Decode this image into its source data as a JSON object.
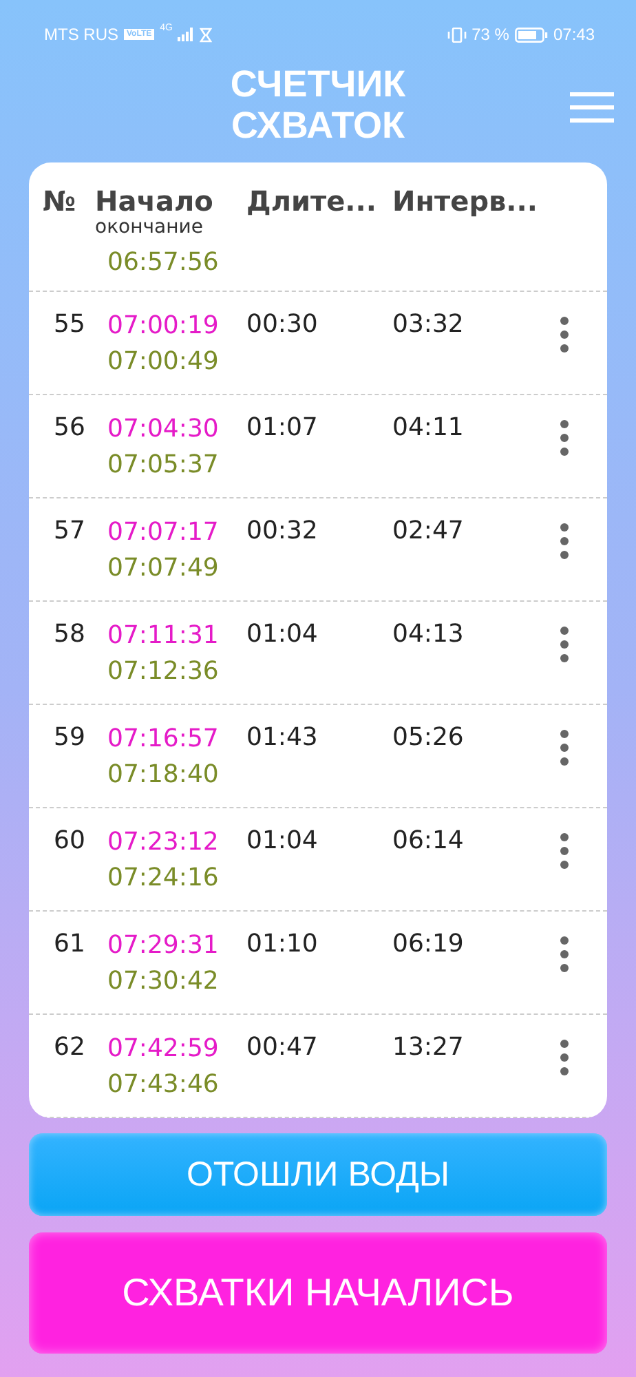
{
  "status_bar": {
    "carrier": "MTS RUS",
    "volte": "VoLTE",
    "network": "4G",
    "battery": "73 %",
    "time": "07:43"
  },
  "title": "СЧЕТЧИК СХВАТОК",
  "table": {
    "columns": [
      {
        "label": "№"
      },
      {
        "label": "Начало",
        "sublabel": "окончание"
      },
      {
        "label": "Длите..."
      },
      {
        "label": "Интерв..."
      }
    ],
    "partial_end": "06:57:56",
    "rows": [
      {
        "number": "55",
        "start": "07:00:19",
        "end": "07:00:49",
        "duration": "00:30",
        "interval": "03:32"
      },
      {
        "number": "56",
        "start": "07:04:30",
        "end": "07:05:37",
        "duration": "01:07",
        "interval": "04:11"
      },
      {
        "number": "57",
        "start": "07:07:17",
        "end": "07:07:49",
        "duration": "00:32",
        "interval": "02:47"
      },
      {
        "number": "58",
        "start": "07:11:31",
        "end": "07:12:36",
        "duration": "01:04",
        "interval": "04:13"
      },
      {
        "number": "59",
        "start": "07:16:57",
        "end": "07:18:40",
        "duration": "01:43",
        "interval": "05:26"
      },
      {
        "number": "60",
        "start": "07:23:12",
        "end": "07:24:16",
        "duration": "01:04",
        "interval": "06:14"
      },
      {
        "number": "61",
        "start": "07:29:31",
        "end": "07:30:42",
        "duration": "01:10",
        "interval": "06:19"
      },
      {
        "number": "62",
        "start": "07:42:59",
        "end": "07:43:46",
        "duration": "00:47",
        "interval": "13:27"
      }
    ]
  },
  "buttons": [
    {
      "label": "ОТОШЛИ ВОДЫ",
      "kind": "water"
    },
    {
      "label": "СХВАТКИ НАЧАЛИСЬ",
      "kind": "start"
    }
  ]
}
